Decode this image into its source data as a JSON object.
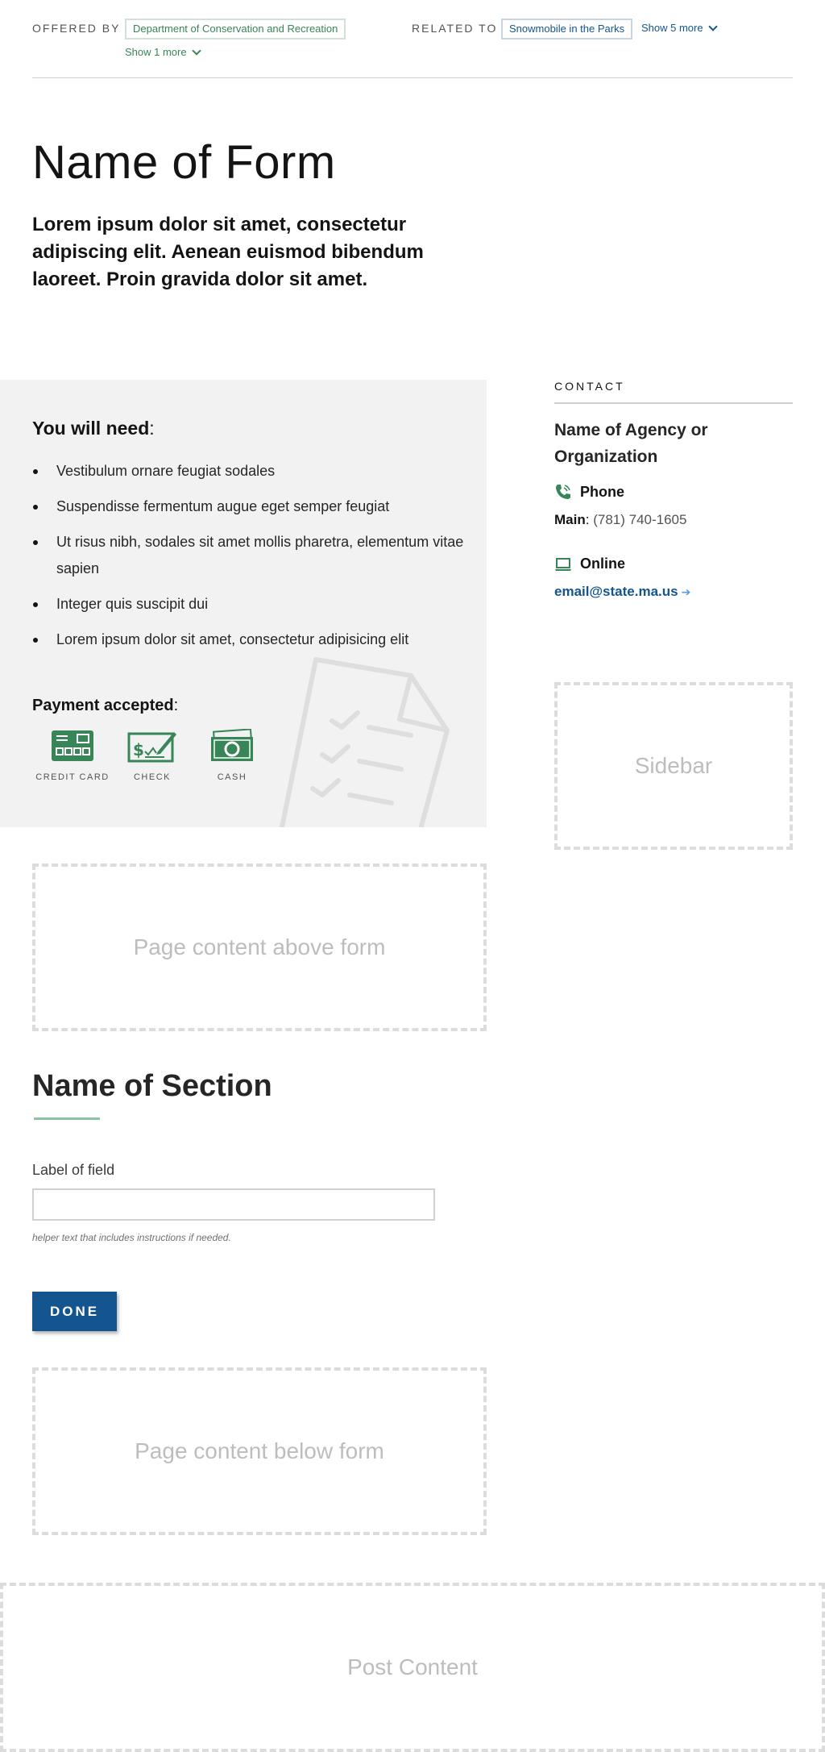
{
  "meta": {
    "offered_by_label": "OFFERED BY",
    "offered_by_tag": "Department of Conservation and Recreation",
    "offered_more": "Show 1 more",
    "related_label": "RELATED TO",
    "related_tag": "Snowmobile in the Parks",
    "related_more": "Show 5 more"
  },
  "hero": {
    "title": "Name of Form",
    "lede": "Lorem ipsum dolor sit amet, consectetur adipiscing elit. Aenean euismod bibendum laoreet. Proin gravida dolor sit amet."
  },
  "needs": {
    "title": "You will need",
    "colon": ":",
    "items": [
      "Vestibulum ornare feugiat sodales",
      "Suspendisse fermentum augue eget semper feugiat",
      "Ut risus nibh, sodales sit amet mollis pharetra, elementum vitae sapien",
      "Integer quis suscipit dui",
      "Lorem ipsum dolor sit amet, consectetur adipisicing elit"
    ],
    "payment_title": "Payment accepted",
    "payment_colon": ":",
    "payments": [
      {
        "label": "CREDIT CARD",
        "icon": "credit-card-icon"
      },
      {
        "label": "CHECK",
        "icon": "check-icon"
      },
      {
        "label": "CASH",
        "icon": "cash-icon"
      }
    ]
  },
  "contact": {
    "caption": "CONTACT",
    "org": "Name of Agency or Organization",
    "phone_heading": "Phone",
    "main_label": "Main",
    "main_colon": ":",
    "main_number": "(781) 740-1605",
    "online_heading": "Online",
    "email": "email@state.ma.us"
  },
  "placeholders": {
    "sidebar": "Sidebar",
    "above": "Page content above form",
    "below": "Page content below form",
    "post": "Post Content"
  },
  "form": {
    "section_title": "Name of Section",
    "field_label": "Label of field",
    "field_value": "",
    "helper": "helper text that includes instructions if needed.",
    "done_label": "DONE"
  },
  "colors": {
    "green": "#388557",
    "blue": "#14558f",
    "panel_gray": "#f2f2f2"
  }
}
